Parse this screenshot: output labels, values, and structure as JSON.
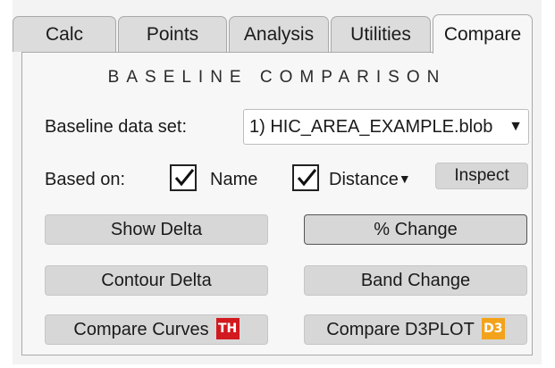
{
  "tabs": [
    {
      "label": "Calc",
      "active": false
    },
    {
      "label": "Points",
      "active": false
    },
    {
      "label": "Analysis",
      "active": false
    },
    {
      "label": "Utilities",
      "active": false
    },
    {
      "label": "Compare",
      "active": true
    }
  ],
  "section_title": "BASELINE COMPARISON",
  "baseline": {
    "label": "Baseline data set:",
    "selected_value": "1) HIC_AREA_EXAMPLE.blob",
    "arrow_icon": "triangle-down-icon"
  },
  "based_on": {
    "label": "Based on:",
    "name_checkbox": {
      "label": "Name",
      "checked": true
    },
    "distance_checkbox": {
      "label": "Distance",
      "checked": true,
      "arrow": "▼"
    },
    "inspect_label": "Inspect"
  },
  "buttons": {
    "show_delta": "Show Delta",
    "percent_change": "% Change",
    "contour_delta": "Contour Delta",
    "band_change": "Band Change",
    "compare_curves": "Compare Curves",
    "compare_d3plot": "Compare D3PLOT"
  },
  "badges": {
    "th": {
      "text": "TH",
      "color": "#d1191f"
    },
    "d3": {
      "text": "D3",
      "color": "#f2a31b"
    }
  }
}
